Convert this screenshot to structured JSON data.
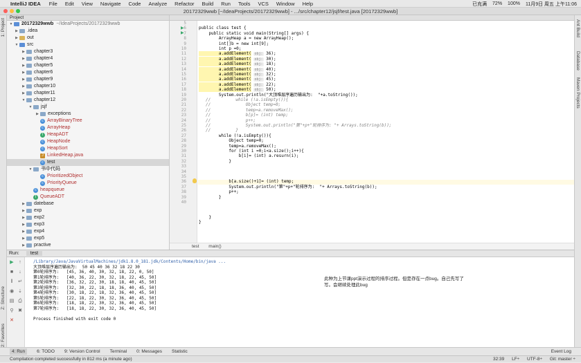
{
  "menubar": {
    "apple": "",
    "app_name": "IntelliJ IDEA",
    "items": [
      "File",
      "Edit",
      "View",
      "Navigate",
      "Code",
      "Analyze",
      "Refactor",
      "Build",
      "Run",
      "Tools",
      "VCS",
      "Window",
      "Help"
    ],
    "status": {
      "charging": "已充满",
      "battery": "72%",
      "wifi": "",
      "bt": "",
      "input": "100%",
      "datetime": "11月9日 周五 上午11:06"
    }
  },
  "window": {
    "title": "20172329wwb [~/IdeaProjects/20172329wwb] - .../src/chapter12/jsjf/test.java [20172329wwb]"
  },
  "left_strip": {
    "project": "1: Project",
    "structure": "Z: Structure",
    "favorites": "2: Favorites"
  },
  "right_strip": {
    "ant": "Ant Build",
    "database": "Database",
    "maven": "Maven Projects"
  },
  "project_panel": {
    "tab": "Project",
    "root": {
      "name": "20172329wwb",
      "path": "~/IdeaProjects/20172329wwb"
    },
    "items": [
      {
        "label": ".idea"
      },
      {
        "label": "out"
      },
      {
        "label": "src"
      },
      {
        "label": "chapter3"
      },
      {
        "label": "chapter4"
      },
      {
        "label": "chapter5"
      },
      {
        "label": "chapter6"
      },
      {
        "label": "chapter9"
      },
      {
        "label": "chapter10"
      },
      {
        "label": "chapter11"
      },
      {
        "label": "chapter12"
      },
      {
        "label": "jsjf"
      },
      {
        "label": "exceptions"
      },
      {
        "label": "ArrayBinaryTree"
      },
      {
        "label": "ArrayHeap"
      },
      {
        "label": "HeapADT"
      },
      {
        "label": "HeapNode"
      },
      {
        "label": "HeapSort"
      },
      {
        "label": "LinkedHeap.java"
      },
      {
        "label": "test"
      },
      {
        "label": "书中代码"
      },
      {
        "label": "PrioritizedObject"
      },
      {
        "label": "PriorityQueue"
      },
      {
        "label": "heapqueue"
      },
      {
        "label": "QueueADT"
      },
      {
        "label": "datebase"
      },
      {
        "label": "exp"
      },
      {
        "label": "exp2"
      },
      {
        "label": "exp3"
      },
      {
        "label": "exp4"
      },
      {
        "label": "exp5"
      },
      {
        "label": "practive"
      }
    ]
  },
  "editor": {
    "line_numbers": [
      "5",
      "6",
      "7",
      "8",
      "9",
      "10",
      "11",
      "12",
      "13",
      "14",
      "15",
      "16",
      "17",
      "18",
      "19",
      "20",
      "21",
      "22",
      "23",
      "24",
      "25",
      "26",
      "27",
      "28",
      "29",
      "30",
      "31",
      "32",
      "33",
      "34",
      "35",
      "36",
      "37",
      "38",
      "39",
      "40"
    ],
    "code": {
      "l6": "public class test {",
      "l7": "    public static void main(String[] args) {",
      "l8": "        ArrayHeap a = new ArrayHeap();",
      "l9": "        int[]b = new int[9];",
      "l10": "        int p =0;",
      "add_prefix": "        a.addElement(",
      "hint": "obj:",
      "add_values": [
        "36",
        "30",
        "18",
        "40",
        "32",
        "45",
        "22",
        "50"
      ],
      "add_suffix": ");",
      "l19": "        System.out.println(\"大顶堆层序遍历输出为:  \"+a.toString());",
      "c1": "//          while (!a.isEmpty()){",
      "c2": "//              Object temp=0;",
      "c3": "//              temp=a.removeMax();",
      "c4": "//              b[p]= (int) temp;",
      "c5": "//              p++;",
      "c6": "//              System.out.println(\"第\"+p+\"轮排序为: \"+ Arrays.toString(b));",
      "c7": "//          }",
      "l27": "        while (!a.isEmpty()){",
      "l28": "            Object temp=0;",
      "l29": "            temp=a.removeMax();",
      "l30": "            for (int i =0;i<a.size();i++){",
      "l31": "                b[i]= (int) a.resurn(i);",
      "l32": "            }",
      "l33": "            b[a.size()+1]= (int) temp;",
      "l34": "            System.out.println(\"第\"+p+\"轮排序为:  \"+ Arrays.toString(b));",
      "l35": "            p++;",
      "l36": "        }",
      "l38": "",
      "l39": "    }",
      "l40": "}"
    },
    "breadcrumbs": [
      "test",
      "main()"
    ]
  },
  "run_panel": {
    "label": "Run:",
    "config": "test",
    "cmd": "/Library/Java/JavaVirtualMachines/jdk1.8.0_181.jdk/Contents/Home/bin/java ...",
    "output": [
      "大顶堆层序遍历输出为:  50 45 40 36 32 18 22 30",
      "第0轮排序为:   [45, 36, 40, 30, 32, 18, 22, 0, 50]",
      "第1轮排序为:   [40, 36, 22, 30, 32, 18, 22, 45, 50]",
      "第2轮排序为:   [36, 32, 22, 30, 18, 18, 40, 45, 50]",
      "第3轮排序为:   [32, 30, 22, 18, 18, 36, 40, 45, 50]",
      "第4轮排序为:   [30, 18, 22, 18, 32, 36, 40, 45, 50]",
      "第5轮排序为:   [22, 18, 22, 30, 32, 36, 40, 45, 50]",
      "第6轮排序为:   [18, 18, 22, 30, 32, 36, 40, 45, 50]",
      "第7轮排序为:   [18, 18, 22, 30, 32, 36, 40, 45, 50]"
    ],
    "finished": "Process finished with exit code 0",
    "note_line1": "此种为上节课ppt演示过程的排序过程。但是存在一点bug。自己先写了",
    "note_line2": "写。会继续处理此bug"
  },
  "tool_buttons": [
    "4: Run",
    "6: TODO",
    "9: Version Control",
    "Terminal",
    "0: Messages",
    "Statistic"
  ],
  "event_log": "Event Log",
  "status_bar": {
    "message": "Compilation completed successfully in 812 ms (a minute ago)",
    "position": "32:39",
    "line_sep": "LF÷",
    "encoding": "UTF-8÷",
    "vcs": "Git: master ÷"
  }
}
